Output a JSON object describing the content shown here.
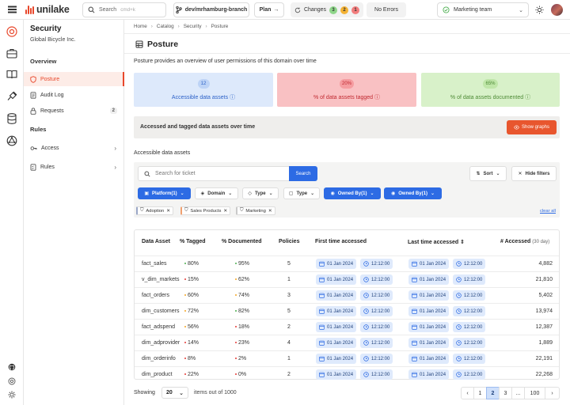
{
  "topbar": {
    "logo_text": "unilake",
    "search_label": "Search",
    "search_shortcut": "cmd+k",
    "branch": "dev/mrhamburg-branch",
    "plan_label": "Plan",
    "changes_label": "Changes",
    "changes_badges": [
      {
        "value": "3",
        "color": "#8fd68a"
      },
      {
        "value": "2",
        "color": "#f5b335"
      },
      {
        "value": "1",
        "color": "#f37d7d"
      }
    ],
    "errors_label": "No Errors",
    "team": "Marketing team"
  },
  "rail": [
    "target-icon",
    "briefcase-icon",
    "book-icon",
    "plug-icon",
    "database-icon",
    "network-icon",
    "github-icon",
    "settings-icon",
    "gear-icon"
  ],
  "sidebar": {
    "title": "Security",
    "subtitle": "Global Bicycle Inc.",
    "overview_heading": "Overview",
    "overview_items": [
      {
        "label": "Posture",
        "icon": "shield-icon"
      },
      {
        "label": "Audit Log",
        "icon": "log-icon"
      },
      {
        "label": "Requests",
        "icon": "lock-icon",
        "count": "2"
      }
    ],
    "rules_heading": "Rules",
    "rules_items": [
      {
        "label": "Access",
        "icon": "key-icon"
      },
      {
        "label": "Rules",
        "icon": "rules-icon"
      }
    ]
  },
  "breadcrumb": [
    "Home",
    "Catalog",
    "Security",
    "Posture"
  ],
  "page": {
    "title": "Posture",
    "intro": "Posture provides an overview of user permissions of this domain over time"
  },
  "cards": [
    {
      "value": "12",
      "label": "Accessible data assets",
      "bg": "#dde9fb",
      "chip": "#bdd3f6",
      "fg": "#2d62c8"
    },
    {
      "value": "20%",
      "label": "% of data assets tagged",
      "bg": "#f9c1c3",
      "chip": "#f59ca0",
      "fg": "#c12a31"
    },
    {
      "value": "65%",
      "label": "% of data assets documented",
      "bg": "#d8f1c9",
      "chip": "#bfe6a8",
      "fg": "#4d8a35"
    }
  ],
  "banner": {
    "text": "Accessed and tagged data assets over time",
    "button": "Show graphs"
  },
  "section_label": "Accessible data assets",
  "filters": {
    "search_placeholder": "Search for ticket",
    "search_button": "Search",
    "sort_label": "Sort",
    "hide_filters_label": "Hide filters",
    "chips": [
      {
        "label": "Platform(1)",
        "active": true
      },
      {
        "label": "Domain",
        "active": false
      },
      {
        "label": "Type",
        "active": false
      },
      {
        "label": "Type",
        "active": false
      },
      {
        "label": "Owned By(1)",
        "active": true
      },
      {
        "label": "Owned By(1)",
        "active": true
      }
    ],
    "tags": [
      {
        "label": "Adoption",
        "color": "#9aa7c7"
      },
      {
        "label": "Sales Products",
        "color": "#f0a070"
      },
      {
        "label": "Marketing",
        "color": "#c9c9c9"
      }
    ],
    "clear_all": "clear all"
  },
  "table": {
    "headers": {
      "asset": "Data Asset",
      "tagged": "% Tagged",
      "documented": "% Documented",
      "policies": "Policies",
      "first": "First time accessed",
      "last": "Last time accessed",
      "accessed": "# Accessed",
      "accessed_sub": "(30 day)"
    },
    "rows": [
      {
        "asset": "fact_sales",
        "tagged": "80%",
        "tag_color": "#4caf50",
        "documented": "95%",
        "doc_color": "#4caf50",
        "policies": "5",
        "first_date": "01 Jan 2024",
        "first_time": "12:12:00",
        "last_date": "01 Jan 2024",
        "last_time": "12:12:00",
        "accessed": "4,882"
      },
      {
        "asset": "v_dim_markets",
        "tagged": "15%",
        "tag_color": "#e53935",
        "documented": "62%",
        "doc_color": "#f5a623",
        "policies": "1",
        "first_date": "01 Jan 2024",
        "first_time": "12:12:00",
        "last_date": "01 Jan 2024",
        "last_time": "12:12:00",
        "accessed": "21,810"
      },
      {
        "asset": "fact_orders",
        "tagged": "60%",
        "tag_color": "#f5a623",
        "documented": "74%",
        "doc_color": "#f5a623",
        "policies": "3",
        "first_date": "01 Jan 2024",
        "first_time": "12:12:00",
        "last_date": "01 Jan 2024",
        "last_time": "12:12:00",
        "accessed": "5,402"
      },
      {
        "asset": "dim_customers",
        "tagged": "72%",
        "tag_color": "#f5a623",
        "documented": "82%",
        "doc_color": "#4caf50",
        "policies": "5",
        "first_date": "01 Jan 2024",
        "first_time": "12:12:00",
        "last_date": "01 Jan 2024",
        "last_time": "12:12:00",
        "accessed": "13,974"
      },
      {
        "asset": "fact_adspend",
        "tagged": "56%",
        "tag_color": "#f5a623",
        "documented": "18%",
        "doc_color": "#e53935",
        "policies": "2",
        "first_date": "01 Jan 2024",
        "first_time": "12:12:00",
        "last_date": "01 Jan 2024",
        "last_time": "12:12:00",
        "accessed": "12,387"
      },
      {
        "asset": "dim_adprovider",
        "tagged": "14%",
        "tag_color": "#e53935",
        "documented": "23%",
        "doc_color": "#e53935",
        "policies": "4",
        "first_date": "01 Jan 2024",
        "first_time": "12:12:00",
        "last_date": "01 Jan 2024",
        "last_time": "12:12:00",
        "accessed": "1,889"
      },
      {
        "asset": "dim_orderinfo",
        "tagged": "8%",
        "tag_color": "#e53935",
        "documented": "2%",
        "doc_color": "#e53935",
        "policies": "1",
        "first_date": "01 Jan 2024",
        "first_time": "12:12:00",
        "last_date": "01 Jan 2024",
        "last_time": "12:12:00",
        "accessed": "22,191"
      },
      {
        "asset": "dim_product",
        "tagged": "22%",
        "tag_color": "#e53935",
        "documented": "0%",
        "doc_color": "#e53935",
        "policies": "2",
        "first_date": "01 Jan 2024",
        "first_time": "12:12:00",
        "last_date": "01 Jan 2024",
        "last_time": "12:12:00",
        "accessed": "22,268"
      }
    ]
  },
  "pagination": {
    "showing_label": "Showing",
    "page_size": "20",
    "items_label": "items out of 1000",
    "pages": [
      "1",
      "2",
      "3",
      "...",
      "100"
    ],
    "current": "2"
  }
}
